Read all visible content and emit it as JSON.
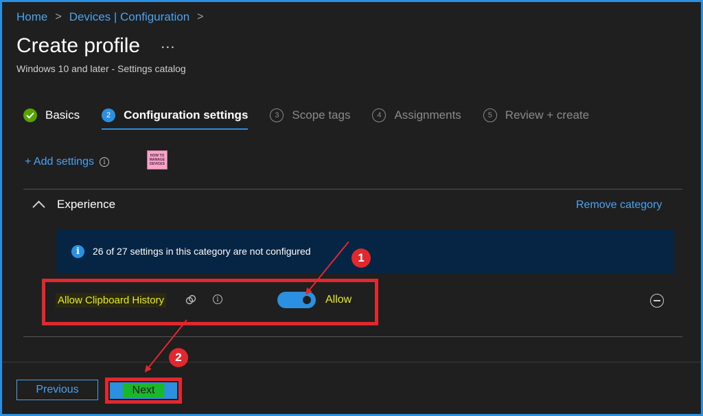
{
  "breadcrumb": {
    "items": [
      "Home",
      "Devices | Configuration"
    ],
    "separator": ">"
  },
  "header": {
    "title": "Create profile",
    "more_label": "...",
    "subtitle": "Windows 10 and later - Settings catalog"
  },
  "steps": [
    {
      "num": "✓",
      "label": "Basics",
      "state": "done"
    },
    {
      "num": "2",
      "label": "Configuration settings",
      "state": "current"
    },
    {
      "num": "3",
      "label": "Scope tags",
      "state": "disabled"
    },
    {
      "num": "4",
      "label": "Assignments",
      "state": "disabled"
    },
    {
      "num": "5",
      "label": "Review + create",
      "state": "disabled"
    }
  ],
  "toolbar": {
    "add_settings": "+ Add settings",
    "info_glyph": "i",
    "logo_lines": [
      "HOW TO",
      "MANAGE",
      "DEVICES"
    ]
  },
  "category": {
    "name": "Experience",
    "remove_label": "Remove category",
    "banner_text": "26 of 27 settings in this category are not configured",
    "banner_icon": "i"
  },
  "setting": {
    "label": "Allow Clipboard History",
    "value_label": "Allow",
    "enabled": true
  },
  "annotations": {
    "badge1": "1",
    "badge2": "2"
  },
  "footer": {
    "previous_label": "Previous",
    "next_label": "Next"
  },
  "colors": {
    "accent": "#2b90e0",
    "link": "#4aa3f0",
    "annotation_red": "#e0282e",
    "highlight_yellow": "#eaea20",
    "success_green": "#57a300"
  }
}
